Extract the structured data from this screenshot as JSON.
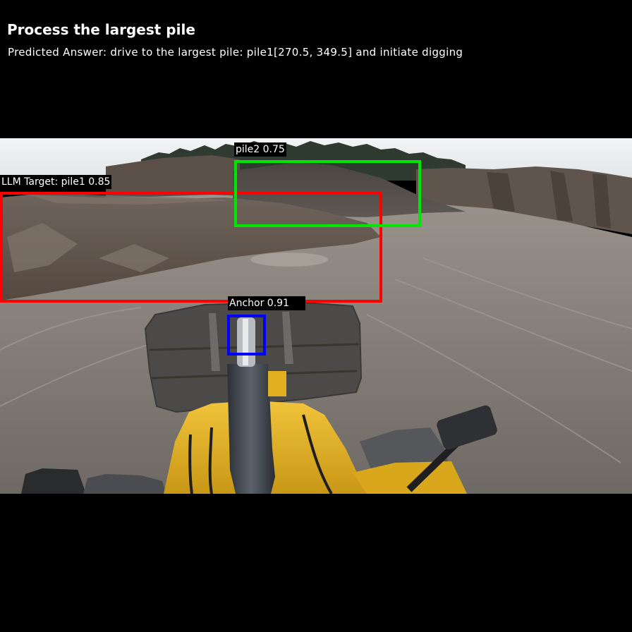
{
  "header": {
    "title": "Process the largest pile",
    "predicted_answer": "Predicted Answer: drive to the largest pile: pile1[270.5, 349.5] and initiate digging"
  },
  "detections": {
    "pile1": {
      "label": "LLM Target: pile1 0.85",
      "color": "#ff0000"
    },
    "pile2": {
      "label": "pile2 0.75",
      "color": "#00e600"
    },
    "anchor": {
      "label": "Anchor 0.91",
      "color": "#0000ff"
    }
  },
  "colors": {
    "background": "#000000",
    "sky": "#e9ecee",
    "ground": "#8a8580",
    "machine_yellow": "#e2b21e"
  }
}
